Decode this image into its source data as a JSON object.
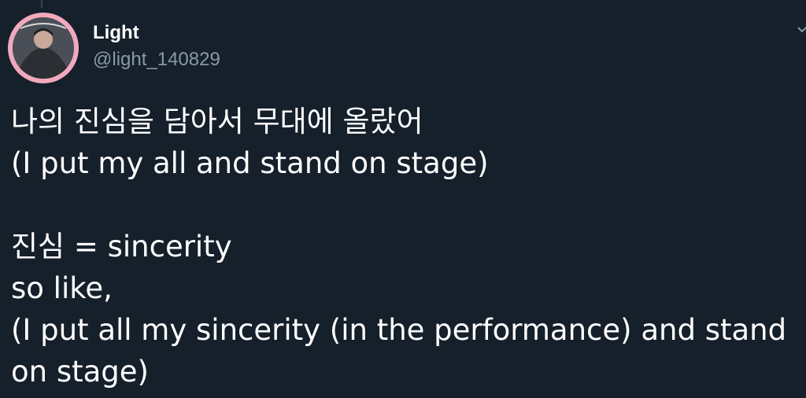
{
  "tweet": {
    "author": {
      "name": "Light",
      "handle": "@light_140829",
      "avatar_icon": "profile-photo"
    },
    "lines": [
      "나의 진심을 담아서 무대에 올랐어",
      "(I put my all and stand on stage)",
      "",
      "진심 = sincerity",
      "so like,",
      "(I put all my sincerity (in the performance) and stand",
      "on stage)"
    ]
  },
  "colors": {
    "background": "#15202b",
    "text": "#ffffff",
    "muted": "#8899a6",
    "avatar_ring": "#f2a9bd"
  }
}
